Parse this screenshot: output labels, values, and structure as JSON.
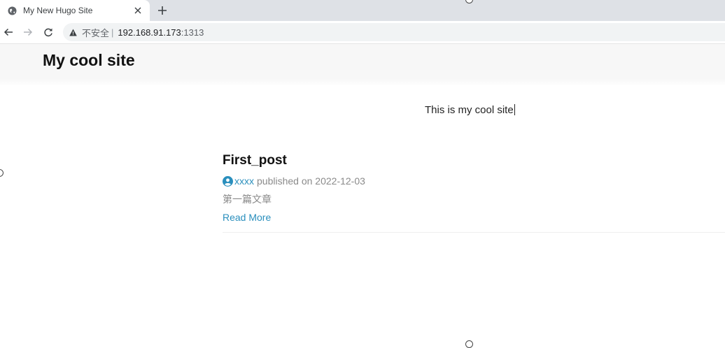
{
  "browser": {
    "tab": {
      "title": "My New Hugo Site",
      "favicon": "globe-icon"
    },
    "new_tab_icon": "plus-icon",
    "address": {
      "security_label": "不安全",
      "separator": "|",
      "host": "192.168.91.173",
      "port": ":1313"
    }
  },
  "site": {
    "title": "My cool site",
    "description": "This is my cool site"
  },
  "posts": [
    {
      "title": "First_post",
      "author": "xxxx",
      "published_label": "published on",
      "date": "2022-12-03",
      "summary": "第一篇文章",
      "read_more": "Read More"
    }
  ],
  "colors": {
    "link": "#2a8fbd",
    "meta_text": "#8a8a8a",
    "header_bg": "#f7f7f7",
    "tabstrip_bg": "#dee1e6"
  }
}
